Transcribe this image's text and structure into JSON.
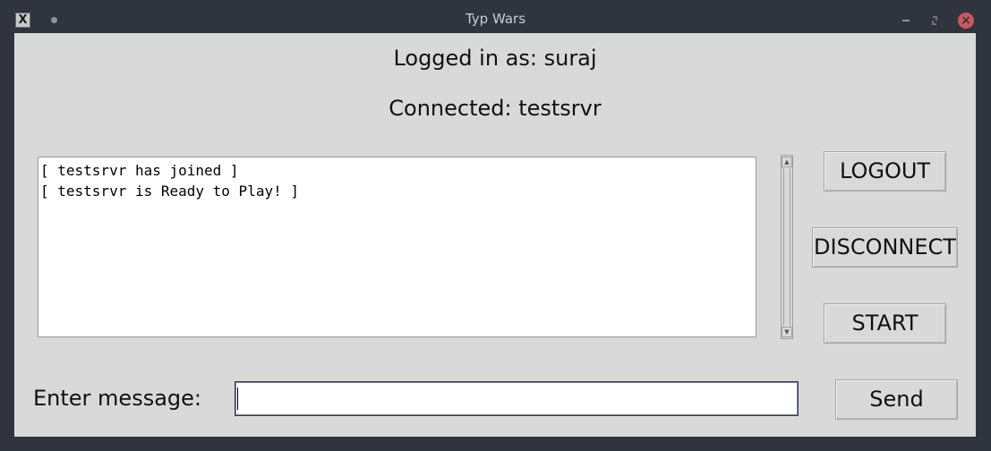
{
  "window": {
    "title": "Typ Wars",
    "icon": "x-app-icon",
    "controls": [
      "minimize-icon",
      "maximize-icon",
      "close-icon"
    ],
    "close_glyph": "×"
  },
  "status": {
    "logged_in": "Logged in as: suraj",
    "connected": "Connected: testsrvr"
  },
  "log": {
    "lines": [
      "[ testsrvr has joined ]",
      "[ testsrvr is Ready to Play! ]"
    ]
  },
  "buttons": {
    "logout": "LOGOUT",
    "disconnect": "DISCONNECT",
    "start": "START",
    "send": "Send"
  },
  "message": {
    "label": "Enter message:",
    "value": ""
  },
  "colors": {
    "titlebar": "#2f343f",
    "client_bg": "#d9d9d9",
    "close_button": "#cc575d"
  }
}
